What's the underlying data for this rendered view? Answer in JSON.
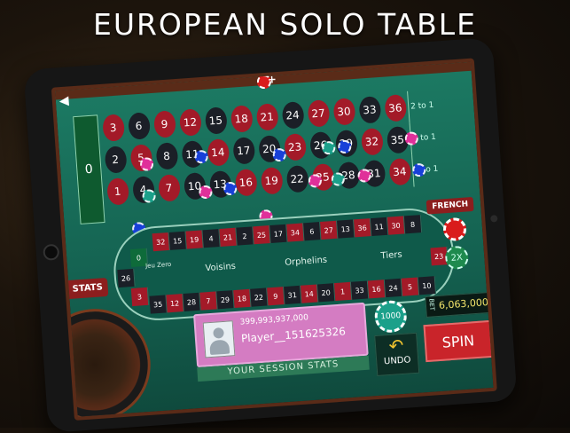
{
  "banner": {
    "title": "EUROPEAN SOLO TABLE"
  },
  "table": {
    "zero": "0",
    "rows": [
      [
        {
          "n": "3",
          "c": "red"
        },
        {
          "n": "6",
          "c": "black"
        },
        {
          "n": "9",
          "c": "red"
        },
        {
          "n": "12",
          "c": "red"
        },
        {
          "n": "15",
          "c": "black"
        },
        {
          "n": "18",
          "c": "red"
        },
        {
          "n": "21",
          "c": "red"
        },
        {
          "n": "24",
          "c": "black"
        },
        {
          "n": "27",
          "c": "red"
        },
        {
          "n": "30",
          "c": "red"
        },
        {
          "n": "33",
          "c": "black"
        },
        {
          "n": "36",
          "c": "red"
        }
      ],
      [
        {
          "n": "2",
          "c": "black"
        },
        {
          "n": "5",
          "c": "red"
        },
        {
          "n": "8",
          "c": "black"
        },
        {
          "n": "11",
          "c": "black"
        },
        {
          "n": "14",
          "c": "red"
        },
        {
          "n": "17",
          "c": "black"
        },
        {
          "n": "20",
          "c": "black"
        },
        {
          "n": "23",
          "c": "red"
        },
        {
          "n": "26",
          "c": "black"
        },
        {
          "n": "29",
          "c": "black"
        },
        {
          "n": "32",
          "c": "red"
        },
        {
          "n": "35",
          "c": "black"
        }
      ],
      [
        {
          "n": "1",
          "c": "red"
        },
        {
          "n": "4",
          "c": "black"
        },
        {
          "n": "7",
          "c": "red"
        },
        {
          "n": "10",
          "c": "black"
        },
        {
          "n": "13",
          "c": "black"
        },
        {
          "n": "16",
          "c": "red"
        },
        {
          "n": "19",
          "c": "red"
        },
        {
          "n": "22",
          "c": "black"
        },
        {
          "n": "25",
          "c": "red"
        },
        {
          "n": "28",
          "c": "black"
        },
        {
          "n": "31",
          "c": "black"
        },
        {
          "n": "34",
          "c": "red"
        }
      ]
    ],
    "column_bets": [
      "2 to 1",
      "2 to 1",
      "2 to 1"
    ]
  },
  "track": {
    "top": [
      {
        "n": "32",
        "c": "red"
      },
      {
        "n": "15",
        "c": "black"
      },
      {
        "n": "19",
        "c": "red"
      },
      {
        "n": "4",
        "c": "black"
      },
      {
        "n": "21",
        "c": "red"
      },
      {
        "n": "2",
        "c": "black"
      },
      {
        "n": "25",
        "c": "red"
      },
      {
        "n": "17",
        "c": "black"
      },
      {
        "n": "34",
        "c": "red"
      },
      {
        "n": "6",
        "c": "black"
      },
      {
        "n": "27",
        "c": "red"
      },
      {
        "n": "13",
        "c": "black"
      },
      {
        "n": "36",
        "c": "red"
      },
      {
        "n": "11",
        "c": "black"
      },
      {
        "n": "30",
        "c": "red"
      },
      {
        "n": "8",
        "c": "black"
      }
    ],
    "bottom": [
      {
        "n": "35",
        "c": "black"
      },
      {
        "n": "12",
        "c": "red"
      },
      {
        "n": "28",
        "c": "black"
      },
      {
        "n": "7",
        "c": "red"
      },
      {
        "n": "29",
        "c": "black"
      },
      {
        "n": "18",
        "c": "red"
      },
      {
        "n": "22",
        "c": "black"
      },
      {
        "n": "9",
        "c": "red"
      },
      {
        "n": "31",
        "c": "black"
      },
      {
        "n": "14",
        "c": "red"
      },
      {
        "n": "20",
        "c": "black"
      },
      {
        "n": "1",
        "c": "red"
      },
      {
        "n": "33",
        "c": "black"
      },
      {
        "n": "16",
        "c": "red"
      },
      {
        "n": "24",
        "c": "black"
      },
      {
        "n": "5",
        "c": "red"
      },
      {
        "n": "10",
        "c": "black"
      }
    ],
    "left": [
      "0",
      "26",
      "3"
    ],
    "right": [
      "23"
    ],
    "sections": [
      "Voisins",
      "Orphelins",
      "Tiers"
    ],
    "jeu_zero": "Jeu Zero"
  },
  "buttons": {
    "french": "FRENCH",
    "stats": "STATS",
    "undo": "UNDO",
    "spin": "SPIN",
    "multiplier": "2X"
  },
  "player": {
    "balance": "399,993,937,000",
    "name": "Player__151625326",
    "session_stats": "YOUR SESSION STATS"
  },
  "chip": {
    "value": "1000"
  },
  "bet": {
    "label": "BET",
    "value": "6,063,000"
  },
  "colors": {
    "felt": "#1c7a63",
    "red": "#a31a28",
    "black": "#1b1f27",
    "spin": "#c9242a"
  }
}
